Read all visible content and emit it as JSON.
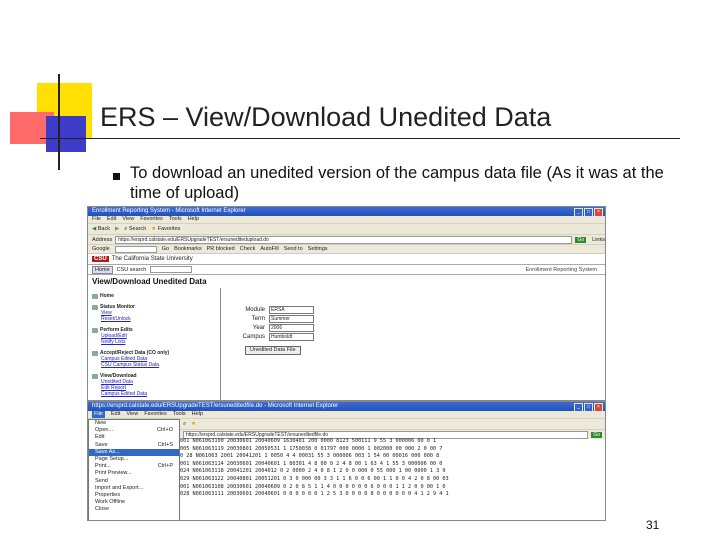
{
  "slide": {
    "title": "ERS – View/Download Unedited Data",
    "bullet": "To download an unedited version of the campus data file (As it was at the time of upload)",
    "page_number": "31"
  },
  "browser1": {
    "window_title": "Enrollment Reporting System - Microsoft Internet Explorer",
    "menu": [
      "File",
      "Edit",
      "View",
      "Favorites",
      "Tools",
      "Help"
    ],
    "toolbar": [
      "Back",
      "Search",
      "Favorites"
    ],
    "address_label": "Address",
    "address_value": "https://ersprd.calstate.edu/ERSUpgradeTEST/ersuneditedupload.do",
    "go_label": "Go",
    "links_label": "Links",
    "google_label": "Google",
    "google_items": [
      "Go",
      "Bookmarks",
      "PR blocked",
      "Check",
      "AutoFill",
      "Send to",
      "Settings"
    ],
    "csu_logo": "CSU",
    "csu_name": "The California State University",
    "home_label": "Home",
    "search_label": "CSU search",
    "ers_label": "Enrollment Reporting System",
    "page_heading": "View/Download Unedited Data",
    "nav": [
      {
        "head": "Home",
        "links": []
      },
      {
        "head": "Status Monitor",
        "links": [
          "View",
          "Reset/Unlock"
        ]
      },
      {
        "head": "Perform Edits",
        "links": [
          "Upload/Edit",
          "Notify Lists"
        ]
      },
      {
        "head": "Accept/Reject Data (CO only)",
        "links": [
          "Campus Edited Data",
          "CSU Campus Status Data"
        ]
      },
      {
        "head": "View/Download",
        "links": [
          "Unedited Data",
          "Edit Report",
          "Campus Edited Data"
        ]
      }
    ],
    "form": [
      {
        "label": "Module",
        "value": "ERSA"
      },
      {
        "label": "Term",
        "value": "Summer"
      },
      {
        "label": "Year",
        "value": "2006"
      },
      {
        "label": "Campus",
        "value": "Humboldt"
      }
    ],
    "unedited_button": "Unedited Data File"
  },
  "browser2": {
    "window_title": "https://ersprd.calstate.edu/ERSUpgradeTEST/ersuneditedfile.do - Microsoft Internet Explorer",
    "menu": [
      "File",
      "Edit",
      "View",
      "Favorites",
      "Tools",
      "Help"
    ],
    "address_value": "https://ersprd.calstate.edu/ERSUpgradeTEST/ersuneditedfile.do",
    "go_label": "Go",
    "file_menu": [
      {
        "label": "New",
        "accel": ""
      },
      {
        "label": "Open...",
        "accel": "Ctrl+O"
      },
      {
        "label": "Edit",
        "accel": ""
      },
      {
        "label": "Save",
        "accel": "Ctrl+S"
      },
      {
        "label": "Save As...",
        "accel": ""
      },
      {
        "label": "Page Setup...",
        "accel": ""
      },
      {
        "label": "Print...",
        "accel": "Ctrl+P"
      },
      {
        "label": "Print Preview...",
        "accel": ""
      },
      {
        "label": "Send",
        "accel": ""
      },
      {
        "label": "Import and Export...",
        "accel": ""
      },
      {
        "label": "Properties",
        "accel": ""
      },
      {
        "label": "Work Offline",
        "accel": ""
      },
      {
        "label": "Close",
        "accel": ""
      }
    ],
    "file_menu_selected": 4,
    "data_lines": [
      "001 N061063100 20030601 20040609 1630401 200 0000 8123 500111 9 55 3 000006 00 0 1",
      "005 N061063119 20030801 20050531 1 1750038 0 01797 000 0000 1 002000 00 000 2 0 00 7",
      "0 28 N061063 2001 20041201 1 0050 4 4 00031 55 3 000006 003 1 54 00 00016 000 000 8",
      "001 N061063114 20030601 20040601 1 80301 4 8 00 0 2 4 8 00 1 63 4 1 55 3 000006 00 0",
      "024 N061063118 20041201 2004012 0 2 0000 2 4 0 8 1 2 0 0 000 0 55 000 1 00 0000 1 3 9",
      "029 N061063122 20040801 20051201 0 3 0 000 00 3 3 1 1 6 0 0 6 00 1 1 0 0 4 2 0 8 00 03",
      "001 N061063108 20030601 20040609 0 2 0 8 5 1 1 4 0 0 0 0 0 0 6 0 0 0 1 1 2 0 0 00 1 0",
      "028 N061063111 20030601 20040601 0 0 0 0 0 0 1 2 5 3 0 0 0 0 8 0 0 0 0 0 0 4 1 2 9 4 1"
    ]
  }
}
